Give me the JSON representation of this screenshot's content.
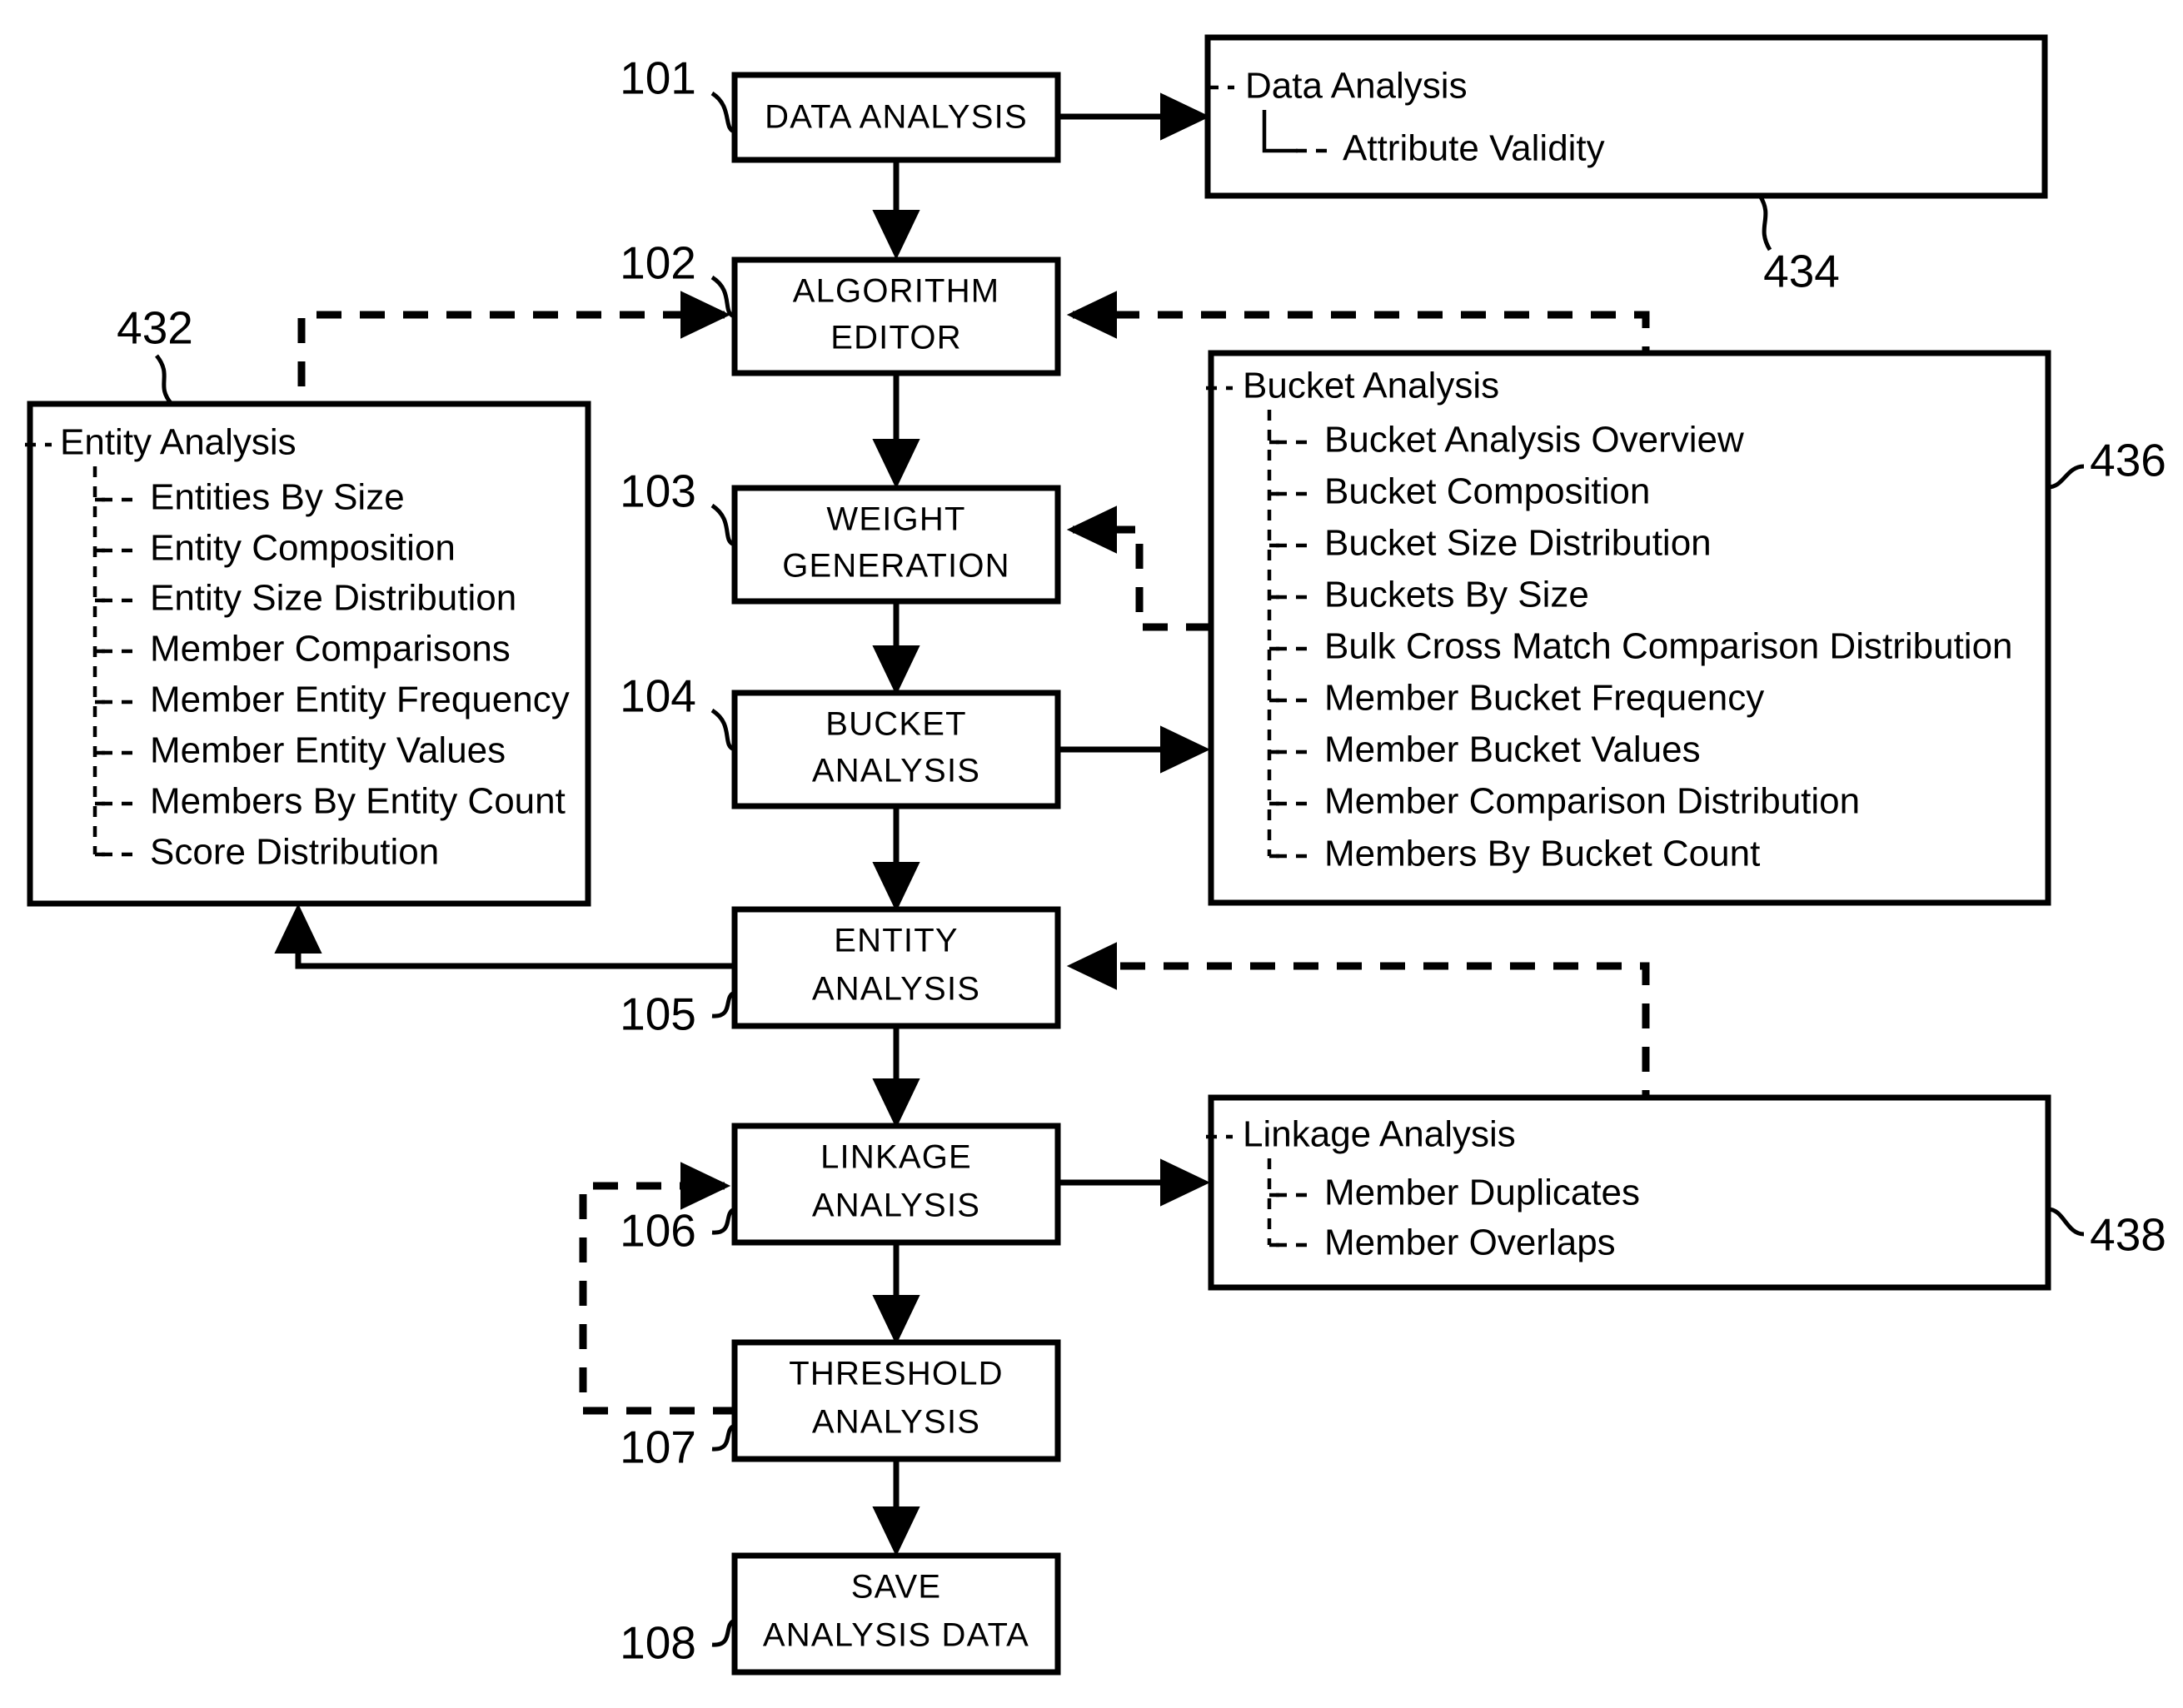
{
  "diagram": {
    "title": "Data analysis workflow flowchart",
    "background_color": "#ffffff",
    "line_color": "#000000"
  },
  "process_steps": [
    {
      "ref": "101",
      "line1": "DATA ANALYSIS",
      "line2": ""
    },
    {
      "ref": "102",
      "line1": "ALGORITHM",
      "line2": "EDITOR"
    },
    {
      "ref": "103",
      "line1": "WEIGHT",
      "line2": "GENERATION"
    },
    {
      "ref": "104",
      "line1": "BUCKET",
      "line2": "ANALYSIS"
    },
    {
      "ref": "105",
      "line1": "ENTITY",
      "line2": "ANALYSIS"
    },
    {
      "ref": "106",
      "line1": "LINKAGE",
      "line2": "ANALYSIS"
    },
    {
      "ref": "107",
      "line1": "THRESHOLD",
      "line2": "ANALYSIS"
    },
    {
      "ref": "108",
      "line1": "SAVE",
      "line2": "ANALYSIS DATA"
    }
  ],
  "panels": [
    {
      "ref": "434",
      "root": "Data Analysis",
      "items": [
        "Attribute Validity"
      ]
    },
    {
      "ref": "432",
      "root": "Entity Analysis",
      "items": [
        "Entities By Size",
        "Entity Composition",
        "Entity Size Distribution",
        "Member Comparisons",
        "Member Entity Frequency",
        "Member Entity Values",
        "Members By Entity Count",
        "Score Distribution"
      ]
    },
    {
      "ref": "436",
      "root": "Bucket Analysis",
      "items": [
        "Bucket Analysis Overview",
        "Bucket Composition",
        "Bucket Size Distribution",
        "Buckets By Size",
        "Bulk Cross Match Comparison Distribution",
        "Member Bucket Frequency",
        "Member Bucket Values",
        "Member Comparison Distribution",
        "Members By Bucket Count"
      ]
    },
    {
      "ref": "438",
      "root": "Linkage Analysis",
      "items": [
        "Member Duplicates",
        "Member Overlaps"
      ]
    }
  ]
}
